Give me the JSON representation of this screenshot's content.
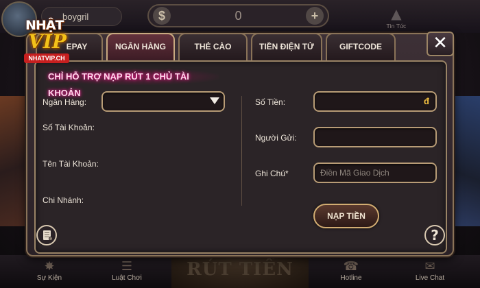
{
  "header": {
    "username": "boygril",
    "balance": "0",
    "balance_minus": "$",
    "balance_plus": "+",
    "topright_label": "Tin Tức"
  },
  "logo": {
    "brand_top": "NHẬT",
    "brand_bottom": "VIP",
    "domain": "NHATVIP.CH"
  },
  "tabs": [
    {
      "label": "EPAY",
      "active": false
    },
    {
      "label": "NGÂN HÀNG",
      "active": true
    },
    {
      "label": "THẺ CÀO",
      "active": false
    },
    {
      "label": "TIỀN ĐIỆN TỬ",
      "active": false
    },
    {
      "label": "GIFTCODE",
      "active": false
    }
  ],
  "close_label": "✕",
  "notice": "CHỈ HỖ TRỢ NẠP RÚT 1 CHỦ TÀI KHOẢN",
  "form_left": {
    "bank_label": "Ngân Hàng:",
    "bank_value": "",
    "account_number_label": "Số Tài Khoản:",
    "account_name_label": "Tên Tài Khoản:",
    "branch_label": "Chi Nhánh:"
  },
  "form_right": {
    "amount_label": "Số Tiền:",
    "amount_currency": "đ",
    "sender_label": "Người Gửi:",
    "note_label": "Ghi Chú*",
    "note_placeholder": "Điền Mã Giao Dịch"
  },
  "submit_label": "NẠP TIỀN",
  "help_label": "?",
  "bottom_nav": [
    {
      "label": "Sự Kiện",
      "icon": "fireworks-icon"
    },
    {
      "label": "Luật Chơi",
      "icon": "rules-icon"
    },
    {
      "label": "Hotline",
      "icon": "phone-icon"
    },
    {
      "label": "Live Chat",
      "icon": "chat-icon"
    }
  ],
  "bottom_center_label": "RÚT TIỀN",
  "colors": {
    "accent_gold": "#b89c76",
    "active_tab": "#64323c",
    "notice_glow": "#e0288a",
    "currency": "#f2c040"
  }
}
